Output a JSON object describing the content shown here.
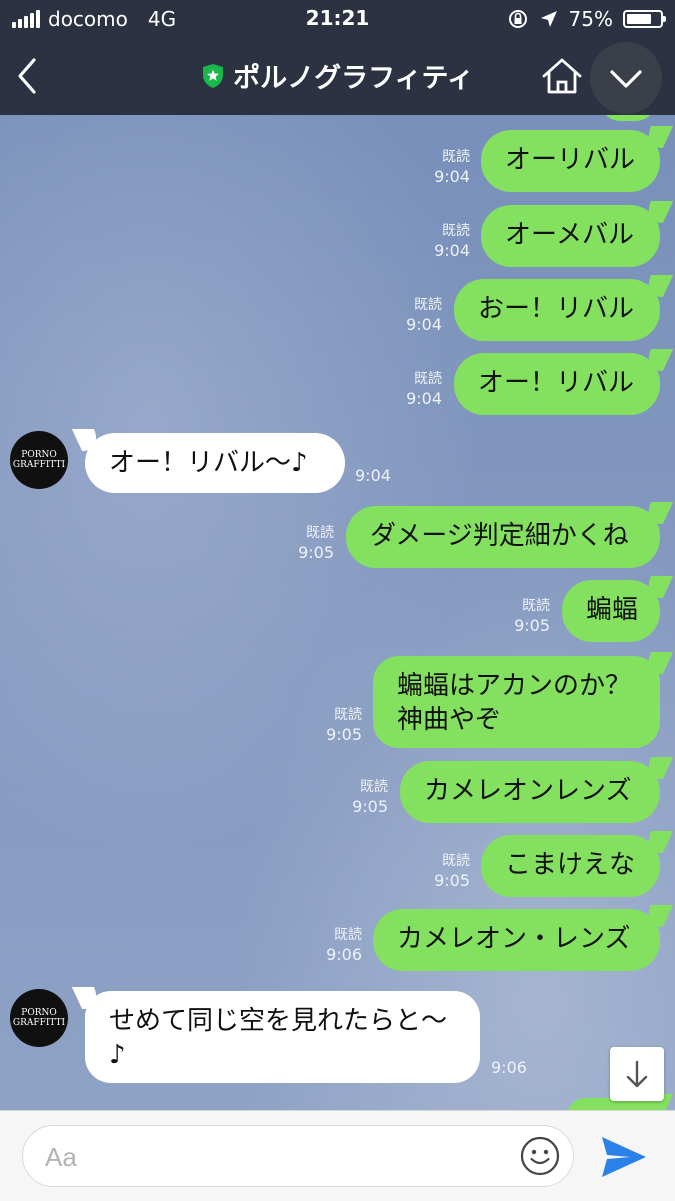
{
  "status_bar": {
    "carrier": "docomo",
    "network": "4G",
    "time": "21:21",
    "battery": "75%",
    "battery_level": 0.75
  },
  "header": {
    "title": "ポルノグラフィティ",
    "accent_color": "#18b84a"
  },
  "chat": {
    "top_time_partial": "9:04",
    "avatar_text": [
      "PORNO",
      "GRAFFITTI"
    ],
    "messages": [
      {
        "text": "オーリバル",
        "read": "既読",
        "time": "9:04"
      },
      {
        "text": "オーメバル",
        "read": "既読",
        "time": "9:04"
      },
      {
        "text": "おー！リバル",
        "read": "既読",
        "time": "9:04"
      },
      {
        "text": "オー！リバル",
        "read": "既読",
        "time": "9:04"
      },
      {
        "text": "オー！リバル〜♪",
        "time": "9:04"
      },
      {
        "text": "ダメージ判定細かくね",
        "read": "既読",
        "time": "9:05"
      },
      {
        "text": "蝙蝠",
        "read": "既読",
        "time": "9:05"
      },
      {
        "text_line1": "蝙蝠はアカンのか？",
        "text_line2": "神曲やぞ",
        "read": "既読",
        "time": "9:05"
      },
      {
        "text": "カメレオンレンズ",
        "read": "既読",
        "time": "9:05"
      },
      {
        "text": "こまけえな",
        "read": "既読",
        "time": "9:05"
      },
      {
        "text": "カメレオン・レンズ",
        "read": "既読",
        "time": "9:06"
      },
      {
        "text_line1": "せめて同じ空を見れたらと〜",
        "text_line2": "♪",
        "time": "9:06"
      }
    ]
  },
  "input": {
    "placeholder": "Aa"
  },
  "colors": {
    "sent_bubble": "#84e15f",
    "received_bubble": "#ffffff",
    "header_bg": "#2c3241",
    "send_icon": "#2a82e8"
  }
}
